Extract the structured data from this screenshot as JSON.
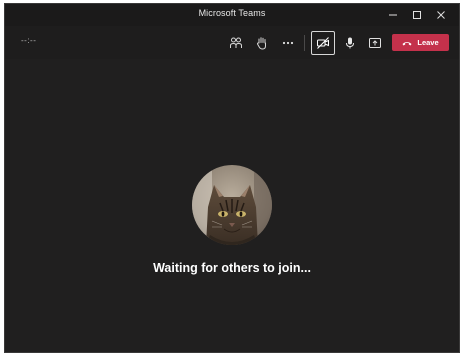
{
  "window": {
    "title": "Microsoft Teams"
  },
  "toolbar": {
    "timer": "--:--",
    "participants_icon": "people-icon",
    "raise_hand_icon": "raise-hand-icon",
    "more_icon": "more-options-icon",
    "camera_icon": "camera-off-icon",
    "mic_icon": "microphone-icon",
    "share_icon": "share-screen-icon",
    "leave_label": "Leave",
    "leave_color": "#c4314b"
  },
  "stage": {
    "status_text": "Waiting for others to join..."
  },
  "colors": {
    "background": "#201f1f",
    "titlebar": "#1b1a1a",
    "accent": "#c4314b"
  }
}
